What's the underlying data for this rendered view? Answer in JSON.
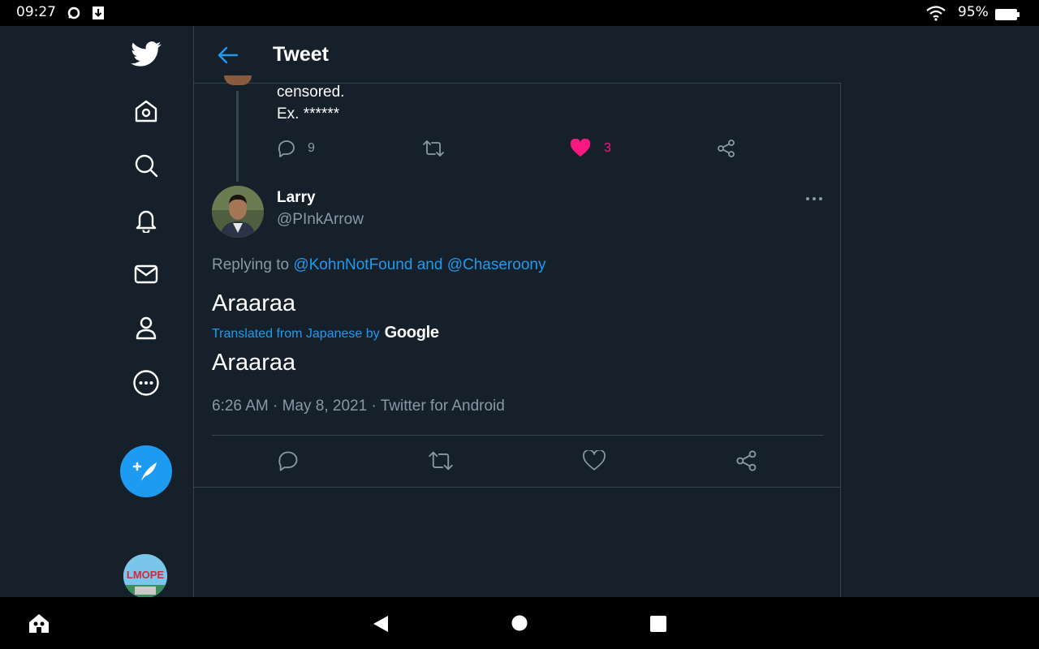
{
  "status_bar": {
    "time": "09:27",
    "battery_percent": "95%"
  },
  "header": {
    "title": "Tweet"
  },
  "previous_tweet": {
    "text_line1": "censored.",
    "text_line2": "Ex. ******",
    "reply_count": "9",
    "like_count": "3"
  },
  "tweet": {
    "name": "Larry",
    "handle": "@PInkArrow",
    "replying_prefix": "Replying to",
    "replying_user1": "@KohnNotFound",
    "replying_and": "and",
    "replying_user2": "@Chaseroony",
    "text_original": "Araaraa",
    "translated_label": "Translated from Japanese by",
    "translator": "Google",
    "text_translated": "Araaraa",
    "meta": "6:26 AM · May 8, 2021 · Twitter for Android"
  },
  "sidebar_avatar_text": "LMOPE",
  "colors": {
    "background": "#15202b",
    "accent": "#1d9bf0",
    "like": "#f91880",
    "muted": "#8899a6",
    "border": "#38444d"
  }
}
